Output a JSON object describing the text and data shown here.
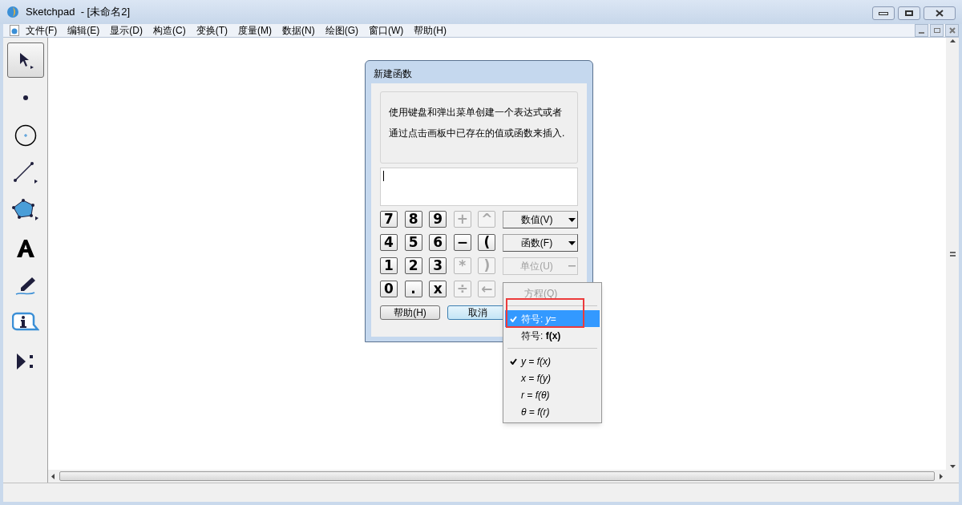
{
  "window": {
    "title": "Sketchpad  - [未命名2]"
  },
  "menu_bar": [
    "文件(F)",
    "编辑(E)",
    "显示(D)",
    "构造(C)",
    "变换(T)",
    "度量(M)",
    "数据(N)",
    "绘图(G)",
    "窗口(W)",
    "帮助(H)"
  ],
  "tools": [
    {
      "kind": "arrow",
      "selected": true
    },
    {
      "kind": "point",
      "selected": false
    },
    {
      "kind": "compass",
      "selected": false
    },
    {
      "kind": "line",
      "selected": false
    },
    {
      "kind": "polygon",
      "selected": false
    },
    {
      "kind": "text",
      "selected": false
    },
    {
      "kind": "marker",
      "selected": false
    },
    {
      "kind": "info",
      "selected": false
    },
    {
      "kind": "custom",
      "selected": false
    }
  ],
  "dialog": {
    "title": "新建函数",
    "instructions": "使用键盘和弹出菜单创建一个表达式或者通过点击画板中已存在的值或函数来插入.",
    "keypad": [
      {
        "label": "7",
        "disabled": false
      },
      {
        "label": "8",
        "disabled": false
      },
      {
        "label": "9",
        "disabled": false
      },
      {
        "label": "+",
        "disabled": true
      },
      {
        "label": "^",
        "disabled": true
      },
      {
        "label": "4",
        "disabled": false
      },
      {
        "label": "5",
        "disabled": false
      },
      {
        "label": "6",
        "disabled": false
      },
      {
        "label": "−",
        "disabled": false
      },
      {
        "label": "(",
        "disabled": false
      },
      {
        "label": "1",
        "disabled": false
      },
      {
        "label": "2",
        "disabled": false
      },
      {
        "label": "3",
        "disabled": false
      },
      {
        "label": "*",
        "disabled": true
      },
      {
        "label": ")",
        "disabled": true
      },
      {
        "label": "0",
        "disabled": false
      },
      {
        "label": ".",
        "disabled": false
      },
      {
        "label": "x",
        "disabled": false
      },
      {
        "label": "÷",
        "disabled": true
      },
      {
        "label": "←",
        "disabled": true
      }
    ],
    "dropdowns": [
      {
        "label": "数值(V)",
        "disabled": false
      },
      {
        "label": "函数(F)",
        "disabled": false
      },
      {
        "label": "单位(U)",
        "disabled": true
      }
    ],
    "buttons": [
      {
        "label": "帮助(H)",
        "default": false
      },
      {
        "label": "取消",
        "default": true
      }
    ]
  },
  "popup_menu": {
    "header": {
      "label": "方程(Q)",
      "disabled": true
    },
    "groups": [
      {
        "kind": "notation",
        "items": [
          {
            "label": "符号: *y*=",
            "checked": true,
            "selected": true
          },
          {
            "label": "符号: **f(x)**",
            "checked": false,
            "selected": false
          }
        ]
      },
      {
        "kind": "formula",
        "items": [
          {
            "label": "y = f(x)",
            "checked": true,
            "selected": false
          },
          {
            "label": "x = f(y)",
            "checked": false,
            "selected": false
          },
          {
            "label": "r = f(θ)",
            "checked": false,
            "selected": false
          },
          {
            "label": "θ = f(r)",
            "checked": false,
            "selected": false
          }
        ]
      }
    ]
  }
}
